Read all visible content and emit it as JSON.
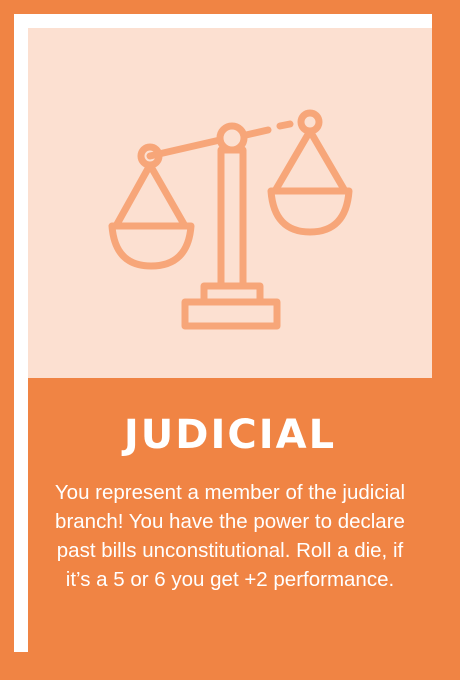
{
  "card": {
    "title": "JUDICIAL",
    "description": "You represent a member of the judicial branch! You have the power to declare past bills unconstitutional. Roll a die, if it’s a 5 or 6 you get +2 performance.",
    "icon": "scales-of-justice-icon",
    "colors": {
      "border": "#F08444",
      "inner_frame": "#FFFFFF",
      "illustration_bg": "#FCE0D1",
      "icon_stroke": "#F7A679",
      "text_panel": "#F08444",
      "text": "#FFFFFF"
    }
  }
}
